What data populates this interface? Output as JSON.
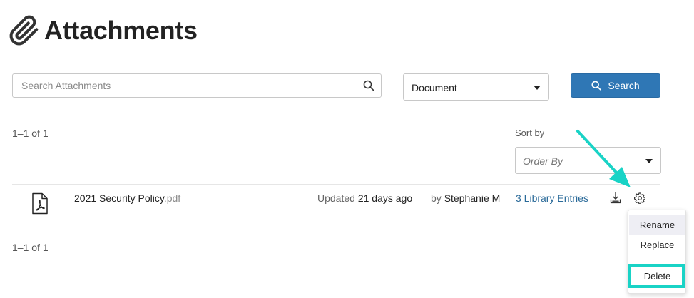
{
  "header": {
    "title": "Attachments",
    "icon": "paperclip-icon"
  },
  "search": {
    "placeholder": "Search Attachments",
    "value": "",
    "icon": "search-icon"
  },
  "type_filter": {
    "selected": "Document"
  },
  "search_button": {
    "label": "Search"
  },
  "results": {
    "count_text": "1–1 of 1"
  },
  "sort": {
    "label": "Sort by",
    "placeholder": "Order By"
  },
  "attachments": [
    {
      "name": "2021 Security Policy",
      "extension": ".pdf",
      "updated_label": "Updated",
      "updated_when": "21 days ago",
      "author_prefix": "by",
      "author": "Stephanie M",
      "library_link": "3 Library Entries"
    }
  ],
  "menu": {
    "items": [
      "Rename",
      "Replace",
      "Delete"
    ]
  },
  "colors": {
    "primary_button": "#2f77b5",
    "link": "#2a6a99",
    "annotation": "#19d3c6"
  }
}
